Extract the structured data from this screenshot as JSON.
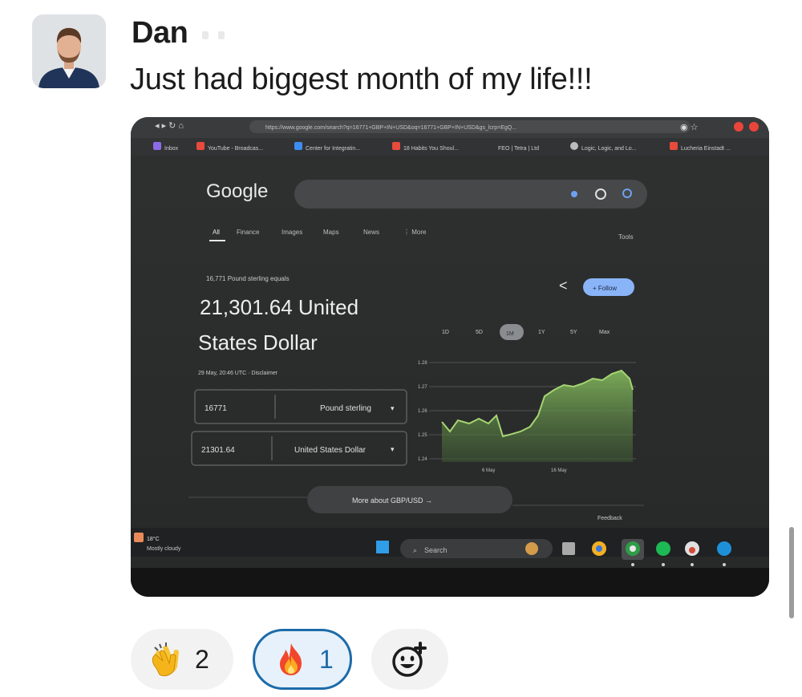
{
  "message": {
    "author": "Dan",
    "text": "Just had biggest month of my life!!!"
  },
  "attachment": {
    "browser": {
      "url": "https://www.google.com/search?q=16771+GBP+IN+USD&oq=16771+GBP+IN+USD&gs_lcrp=EgQ...",
      "bookmarks": [
        "Inbox",
        "YouTube - Broadcas...",
        "Center for Integratin...",
        "18 Habits You Shoul...",
        "FEO | Tetra | Ltd",
        "Logic, Logic, and Lo...",
        "Lucheria Einstadt ..."
      ]
    },
    "google": {
      "logo": "Google",
      "tabs": [
        "All",
        "Finance",
        "Images",
        "Maps",
        "News",
        "⋮ More"
      ],
      "tools": "Tools",
      "equals_label": "16,771 Pound sterling equals",
      "result_line1": "21,301.64 United",
      "result_line2": "States Dollar",
      "timestamp": "29 May, 20:46 UTC · Disclaimer",
      "from_value": "16771",
      "from_currency": "Pound sterling",
      "to_value": "21301.64",
      "to_currency": "United States Dollar",
      "follow": "+ Follow",
      "ranges": [
        "1D",
        "5D",
        "1M",
        "1Y",
        "5Y",
        "Max"
      ],
      "more_about": "More about GBP/USD →",
      "feedback": "Feedback",
      "chart_yticks": [
        "1.28",
        "1.27",
        "1.26",
        "1.25",
        "1.24"
      ],
      "chart_xticks": [
        "6 May",
        "16 May"
      ]
    },
    "taskbar": {
      "weather_temp": "18°C",
      "weather_desc": "Mostly cloudy",
      "search": "Search"
    },
    "colors": {
      "screen_bg": "#2a2b2b",
      "chart_green": "#8bc34a",
      "follow_blue": "#8ab4f8"
    }
  },
  "reactions": [
    {
      "name": "clap",
      "count": "2",
      "selected": false
    },
    {
      "name": "fire",
      "count": "1",
      "selected": true
    }
  ],
  "add_reaction_icon": "add-emoji-icon"
}
